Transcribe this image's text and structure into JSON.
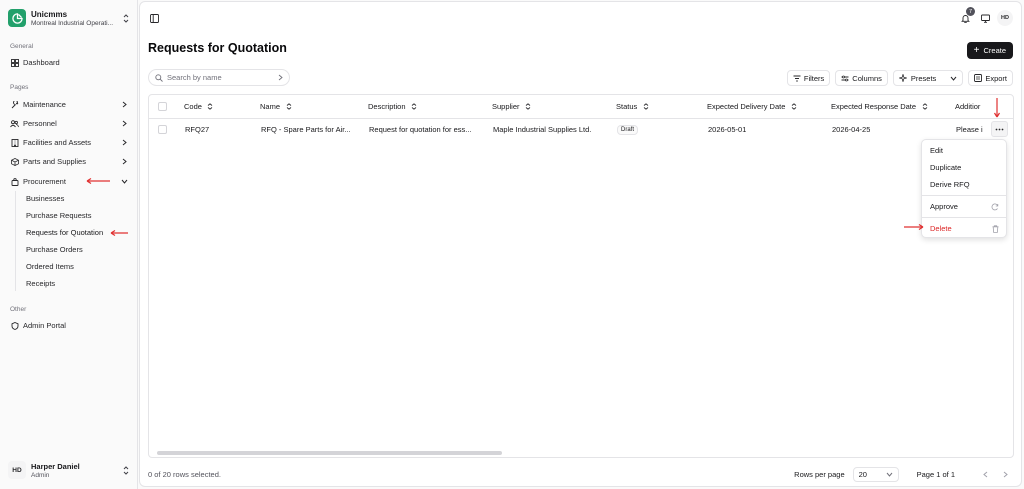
{
  "colors": {
    "accent": "#22a06b",
    "danger": "#dc2626",
    "arrow": "#e03131",
    "primary": "#18181b"
  },
  "org": {
    "name": "Unicmms",
    "subtitle": "Montreal Industrial Operati..."
  },
  "sidebar": {
    "general_label": "General",
    "dashboard": "Dashboard",
    "pages_label": "Pages",
    "items": [
      {
        "label": "Maintenance",
        "icon": "wrench-icon"
      },
      {
        "label": "Personnel",
        "icon": "users-icon"
      },
      {
        "label": "Facilities and Assets",
        "icon": "building-icon"
      },
      {
        "label": "Parts and Supplies",
        "icon": "package-icon"
      },
      {
        "label": "Procurement",
        "icon": "shopping-bag-icon"
      }
    ],
    "procurement_sub": [
      "Businesses",
      "Purchase Requests",
      "Requests for Quotation",
      "Purchase Orders",
      "Ordered Items",
      "Receipts"
    ],
    "other_label": "Other",
    "admin_portal": "Admin Portal"
  },
  "user": {
    "initials": "HD",
    "name": "Harper Daniel",
    "role": "Admin"
  },
  "topbar": {
    "notification_count": "7",
    "avatar_initials": "HD"
  },
  "page": {
    "title": "Requests for Quotation",
    "create_label": "Create"
  },
  "search": {
    "placeholder": "Search by name",
    "value": ""
  },
  "toolbar": {
    "filters": "Filters",
    "columns": "Columns",
    "presets": "Presets",
    "export": "Export"
  },
  "table": {
    "columns": [
      "Code",
      "Name",
      "Description",
      "Supplier",
      "Status",
      "Expected Delivery Date",
      "Expected Response Date",
      "Additior"
    ],
    "rows": [
      {
        "code": "RFQ27",
        "name": "RFQ - Spare Parts for Air...",
        "description": "Request for quotation for ess...",
        "supplier": "Maple Industrial Supplies Ltd.",
        "status": "Draft",
        "delivery": "2026-05-01",
        "response": "2026-04-25",
        "additional": "Please i"
      }
    ]
  },
  "menu": {
    "edit": "Edit",
    "duplicate": "Duplicate",
    "derive": "Derive RFQ",
    "approve": "Approve",
    "delete": "Delete"
  },
  "footer": {
    "selected": "0 of 20 rows selected.",
    "rows_per_page_label": "Rows per page",
    "rows_per_page": "20",
    "page_info": "Page 1 of 1"
  }
}
